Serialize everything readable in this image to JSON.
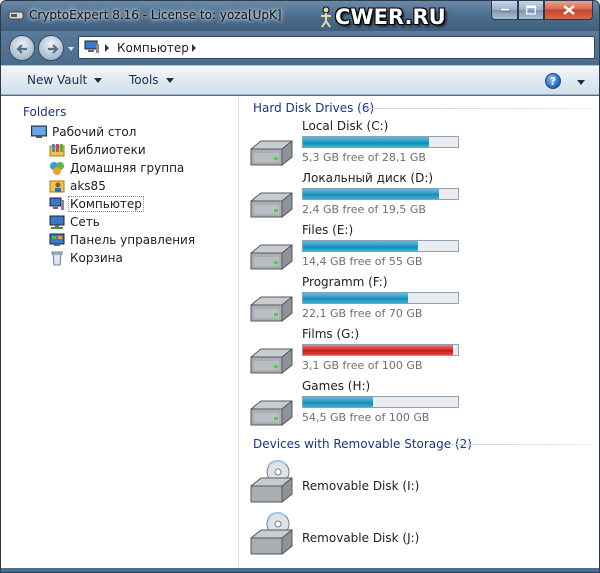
{
  "window": {
    "title": "CryptoExpert 8.16 - License to: yoza[UpK]",
    "watermark": "CWER.RU"
  },
  "address": {
    "location": "Компьютер"
  },
  "toolbar": {
    "new_vault": "New Vault",
    "tools": "Tools",
    "help": "?"
  },
  "sidebar": {
    "title": "Folders",
    "items": [
      {
        "label": "Рабочий стол",
        "icon": "desktop-icon"
      },
      {
        "label": "Библиотеки",
        "icon": "libraries-icon"
      },
      {
        "label": "Домашняя группа",
        "icon": "homegroup-icon"
      },
      {
        "label": "aks85",
        "icon": "user-folder-icon"
      },
      {
        "label": "Компьютер",
        "icon": "computer-icon",
        "selected": true
      },
      {
        "label": "Сеть",
        "icon": "network-icon"
      },
      {
        "label": "Панель управления",
        "icon": "control-panel-icon"
      },
      {
        "label": "Корзина",
        "icon": "recycle-bin-icon"
      }
    ]
  },
  "main": {
    "hdd_header": "Hard Disk Drives (6)",
    "removable_header": "Devices with Removable Storage (2)",
    "drives": [
      {
        "name": "Local Disk (C:)",
        "free": "5,3 GB free of 28,1 GB",
        "used_fraction": 0.81,
        "color": "#26a0c8"
      },
      {
        "name": "Локальный диск (D:)",
        "free": "2,4 GB free of 19,5 GB",
        "used_fraction": 0.88,
        "color": "#26a0c8"
      },
      {
        "name": "Files (E:)",
        "free": "14,4 GB free of 55 GB",
        "used_fraction": 0.74,
        "color": "#26a0c8"
      },
      {
        "name": "Programm (F:)",
        "free": "22,1 GB free of 70 GB",
        "used_fraction": 0.68,
        "color": "#26a0c8"
      },
      {
        "name": "Films (G:)",
        "free": "3,1 GB free of 100 GB",
        "used_fraction": 0.97,
        "color": "#de2a2a"
      },
      {
        "name": "Games (H:)",
        "free": "54,5 GB free of 100 GB",
        "used_fraction": 0.45,
        "color": "#26a0c8"
      }
    ],
    "removable": [
      {
        "name": "Removable Disk (I:)"
      },
      {
        "name": "Removable Disk (J:)"
      }
    ]
  }
}
